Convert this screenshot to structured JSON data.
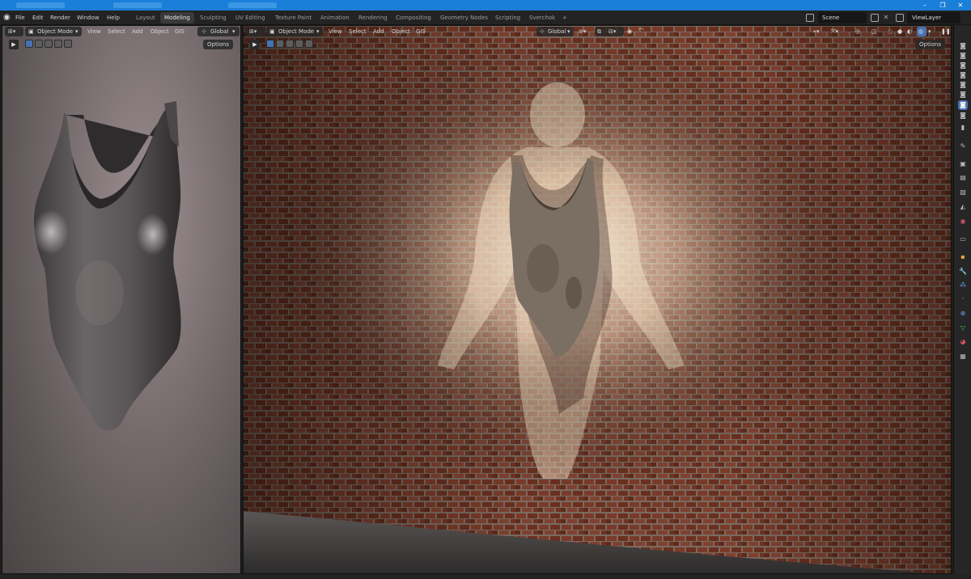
{
  "menu": [
    "File",
    "Edit",
    "Render",
    "Window",
    "Help"
  ],
  "workspaces": [
    "Layout",
    "Modeling",
    "Sculpting",
    "UV Editing",
    "Texture Paint",
    "Animation",
    "Rendering",
    "Compositing",
    "Geometry Nodes",
    "Scripting",
    "Sverchok",
    "+"
  ],
  "active_workspace": "Modeling",
  "scene": "Scene",
  "view_layer": "ViewLayer",
  "left_viewport": {
    "mode": "Object Mode",
    "menus": [
      "View",
      "Select",
      "Add",
      "Object",
      "GIS"
    ],
    "orientation": "Global",
    "options": "Options"
  },
  "right_viewport": {
    "mode": "Object Mode",
    "menus": [
      "View",
      "Select",
      "Add",
      "Object",
      "GIS"
    ],
    "orientation": "Global",
    "options": "Options"
  },
  "colors": {
    "titlebar": "#1a7fd8",
    "accent": "#4772b3",
    "brick": "#6b3424",
    "mortar": "#8a7f74"
  },
  "icons": {
    "logo": "blender-logo-icon",
    "play": "play-icon",
    "properties": [
      "render-icon",
      "output-icon",
      "view-layer-icon",
      "scene-icon",
      "world-icon",
      "collection-icon",
      "object-icon",
      "modifier-icon",
      "particles-icon",
      "physics-icon",
      "constraints-icon",
      "data-icon",
      "material-icon",
      "texture-icon"
    ]
  }
}
